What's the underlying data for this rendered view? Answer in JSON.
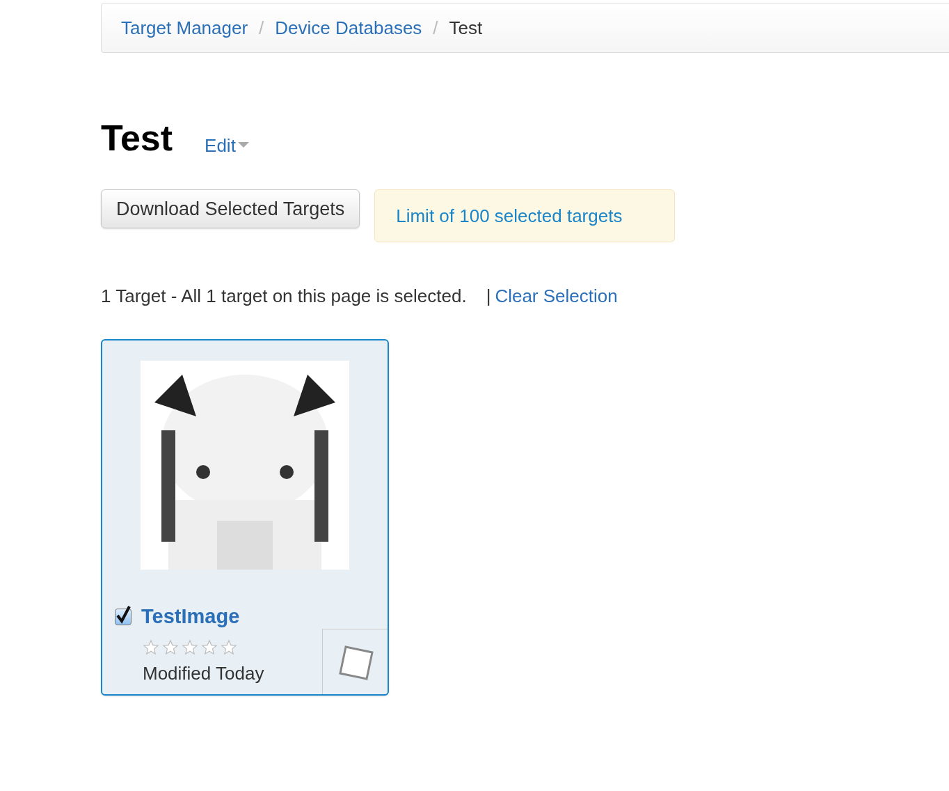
{
  "breadcrumb": [
    {
      "label": "Target Manager",
      "link": true
    },
    {
      "label": "Device Databases",
      "link": true
    },
    {
      "label": "Test",
      "link": false
    }
  ],
  "breadcrumb_dividers": [
    "/",
    "/"
  ],
  "title": "Test",
  "edit_menu": "Edit",
  "download_button": "Download Selected Targets",
  "limit_notice": "Limit of 100 selected targets",
  "selection_status": "1 Target - All 1 target on this page is selected.",
  "separator": "|",
  "clear_selection": "Clear Selection",
  "targets": [
    {
      "name": "TestImage",
      "selected": true,
      "checked": true,
      "stars": 0,
      "modified": "Modified Today",
      "kind": "picture"
    }
  ]
}
